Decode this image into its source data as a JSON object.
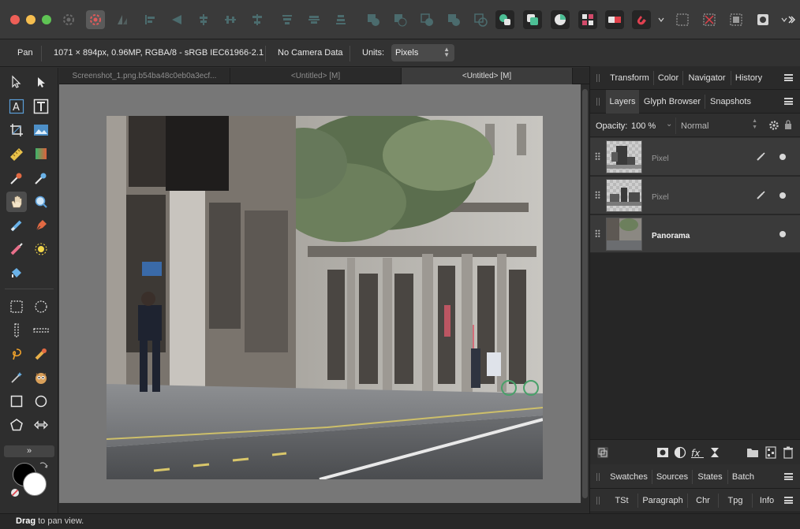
{
  "toolbar": {
    "icons": [
      "app-settings-icon",
      "develop-persona-icon",
      "liquify-persona-icon",
      "align-left-icon",
      "align-center-icon",
      "align-right-icon",
      "distribute-icon",
      "align-top-icon",
      "align-middle-icon",
      "align-bottom-icon",
      "boolean-add-icon",
      "boolean-subtract-icon",
      "boolean-intersect-icon",
      "boolean-divide-icon",
      "quick-mask-icon",
      "mask-icon",
      "snapping-icon",
      "selection-marquee-icon",
      "selection-deselect-icon",
      "selection-invert-icon",
      "selection-refine-icon",
      "more-tools-icon"
    ]
  },
  "context": {
    "tool_name": "Pan",
    "doc_info": "1071 × 894px, 0.96MP, RGBA/8 - sRGB IEC61966-2.1",
    "camera": "No Camera Data",
    "units_label": "Units:",
    "units_value": "Pixels"
  },
  "tabs": [
    {
      "label": "Screenshot_1.png.b54ba48c0eb0a3ecf..."
    },
    {
      "label": "<Untitled> [M]"
    },
    {
      "label": "<Untitled> [M]"
    }
  ],
  "tools": {
    "expand_label": "»"
  },
  "status": {
    "bold": "Drag",
    "text": " to pan view."
  },
  "panels": {
    "top_tabs": [
      "Transform",
      "Color",
      "Navigator",
      "History"
    ],
    "layer_tabs": [
      "Layers",
      "Glyph Browser",
      "Snapshots"
    ],
    "opacity_label": "Opacity:",
    "opacity_value": "100 %",
    "blend_mode": "Normal",
    "layers": [
      {
        "name": "Pixel"
      },
      {
        "name": "Pixel"
      },
      {
        "name": "Panorama"
      }
    ],
    "bottom_tabs_1": [
      "Swatches",
      "Sources",
      "States",
      "Batch"
    ],
    "bottom_tabs_2": [
      "TSt",
      "Paragraph",
      "Chr",
      "Tpg",
      "Info"
    ]
  },
  "colors": {
    "accent_red": "#ee5f57",
    "accent_yellow": "#f6be4f",
    "accent_green": "#5fc454",
    "canvas_bg": "#777777"
  }
}
